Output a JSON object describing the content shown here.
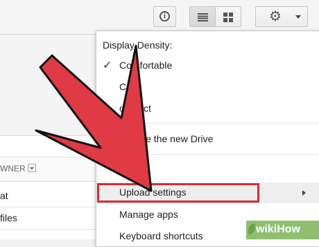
{
  "toolbar": {
    "info_glyph": "i",
    "gear_glyph": "⚙",
    "icons": [
      "info-icon",
      "list-view-icon",
      "grid-view-icon",
      "gear-icon",
      "caret-down-icon"
    ]
  },
  "file_list": {
    "owner_header": "WNER",
    "rows": [
      "at",
      "files"
    ]
  },
  "menu": {
    "density_heading": "Display Density:",
    "density_options": [
      "Comfortable",
      "Cozy",
      "ompact"
    ],
    "selected_density": "Comfortable",
    "check_glyph": "✓",
    "items": [
      {
        "label": "erience the new Drive"
      },
      {
        "label": "ings"
      },
      {
        "label": "Upload settings"
      },
      {
        "label": "Manage apps"
      },
      {
        "label": "Keyboard shortcuts"
      }
    ]
  },
  "overlay": {
    "arrow_color": "#e03a45",
    "highlight_color": "#d82c36"
  },
  "watermark": {
    "text": "wikiHow"
  }
}
